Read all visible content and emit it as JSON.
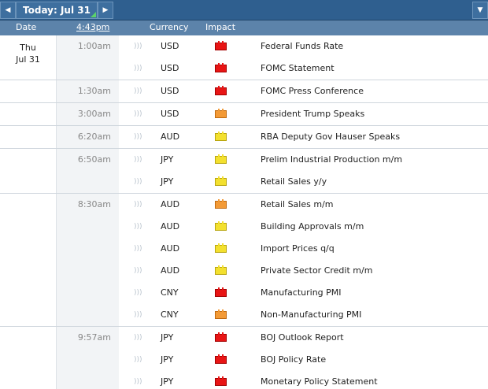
{
  "nav": {
    "prev_icon": "left-arrow",
    "next_icon": "right-arrow",
    "end_icon": "chevron-down",
    "today_label": "Today: Jul 31"
  },
  "columns": {
    "date": "Date",
    "time": "4:43pm",
    "currency": "Currency",
    "impact": "Impact"
  },
  "date": {
    "weekday": "Thu",
    "day": "Jul 31"
  },
  "impact_colors": {
    "high": "#e81515",
    "medium": "#f39a36",
    "low": "#f3e02e"
  },
  "groups": [
    {
      "time": "1:00am",
      "events": [
        {
          "currency": "USD",
          "impact": "high",
          "title": "Federal Funds Rate"
        },
        {
          "currency": "USD",
          "impact": "high",
          "title": "FOMC Statement"
        }
      ]
    },
    {
      "time": "1:30am",
      "events": [
        {
          "currency": "USD",
          "impact": "high",
          "title": "FOMC Press Conference"
        }
      ]
    },
    {
      "time": "3:00am",
      "events": [
        {
          "currency": "USD",
          "impact": "medium",
          "title": "President Trump Speaks"
        }
      ]
    },
    {
      "time": "6:20am",
      "events": [
        {
          "currency": "AUD",
          "impact": "low",
          "title": "RBA Deputy Gov Hauser Speaks"
        }
      ]
    },
    {
      "time": "6:50am",
      "events": [
        {
          "currency": "JPY",
          "impact": "low",
          "title": "Prelim Industrial Production m/m"
        },
        {
          "currency": "JPY",
          "impact": "low",
          "title": "Retail Sales y/y"
        }
      ]
    },
    {
      "time": "8:30am",
      "events": [
        {
          "currency": "AUD",
          "impact": "medium",
          "title": "Retail Sales m/m"
        },
        {
          "currency": "AUD",
          "impact": "low",
          "title": "Building Approvals m/m"
        },
        {
          "currency": "AUD",
          "impact": "low",
          "title": "Import Prices q/q"
        },
        {
          "currency": "AUD",
          "impact": "low",
          "title": "Private Sector Credit m/m"
        },
        {
          "currency": "CNY",
          "impact": "high",
          "title": "Manufacturing PMI"
        },
        {
          "currency": "CNY",
          "impact": "medium",
          "title": "Non-Manufacturing PMI"
        }
      ]
    },
    {
      "time": "9:57am",
      "events": [
        {
          "currency": "JPY",
          "impact": "high",
          "title": "BOJ Outlook Report"
        },
        {
          "currency": "JPY",
          "impact": "high",
          "title": "BOJ Policy Rate"
        },
        {
          "currency": "JPY",
          "impact": "high",
          "title": "Monetary Policy Statement"
        }
      ]
    }
  ]
}
